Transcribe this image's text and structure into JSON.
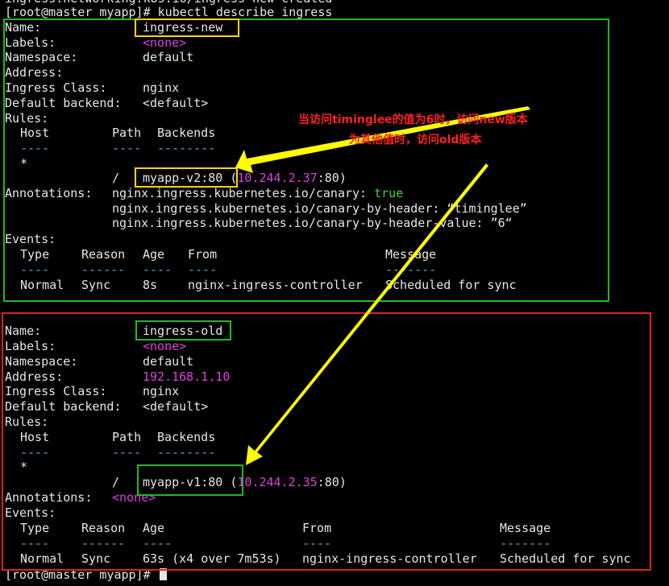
{
  "terminal": {
    "top_cut_line": "ingress.networking.k8s.io/ingress-new created",
    "command_line": "[root@master myapp]# kubectl describe ingress",
    "prompt_end": "[root@master myapp]# "
  },
  "labels": {
    "name": "Name:",
    "labels": "Labels:",
    "namespace": "Namespace:",
    "address": "Address:",
    "ingress_class": "Ingress Class:",
    "default_backend": "Default backend:",
    "rules": "Rules:",
    "annotations": "Annotations:",
    "events": "Events:"
  },
  "rules_header": {
    "host": "Host",
    "path": "Path",
    "backends": "Backends"
  },
  "rules_dashes": {
    "host": "----",
    "path": "----",
    "backends": "--------"
  },
  "events_header": {
    "type": "Type",
    "reason": "Reason",
    "age": "Age",
    "from": "From",
    "message": "Message"
  },
  "events_dashes": {
    "type": "----",
    "reason": "------",
    "age": "----",
    "from": "----",
    "message": "-------"
  },
  "ingress_new": {
    "name": "ingress-new",
    "labels": "<none>",
    "namespace": "default",
    "address": "",
    "ingress_class": "nginx",
    "default_backend": "<default>",
    "host": "*",
    "path": "/",
    "backend": "myapp-v2:80 (",
    "backend_ip": "10.244.2.37",
    "backend_port": ":80)",
    "annotation1_key": "nginx.ingress.kubernetes.io/canary: ",
    "annotation1_val": "true",
    "annotation2": "nginx.ingress.kubernetes.io/canary-by-header: “timinglee”",
    "annotation3": "nginx.ingress.kubernetes.io/canary-by-header-value: ”6“",
    "event": {
      "type": "Normal",
      "reason": "Sync",
      "age": "8s",
      "from": "nginx-ingress-controller",
      "message": "Scheduled for sync"
    }
  },
  "ingress_old": {
    "name": "ingress-old",
    "labels": "<none>",
    "namespace": "default",
    "address": "192.168.1.10",
    "ingress_class": "nginx",
    "default_backend": "<default>",
    "host": "*",
    "path": "/",
    "backend": "myapp-v1:80 (",
    "backend_ip": "10.244.2.35",
    "backend_port": ":80)",
    "annotations": "<none>",
    "event": {
      "type": "Normal",
      "reason": "Sync",
      "age": "63s (x4 over 7m53s)",
      "from": "nginx-ingress-controller",
      "message": "Scheduled for sync"
    }
  },
  "annotation_note": {
    "line1": "当访问timinglee的值为6时，访问new版本",
    "line2": "为其他值时，访问old版本"
  },
  "colors": {
    "green_box": "#22b822",
    "red_box": "#e02020",
    "yellow_box": "#ffd800",
    "arrow": "#ffff00",
    "note_text": "#ff2020"
  }
}
